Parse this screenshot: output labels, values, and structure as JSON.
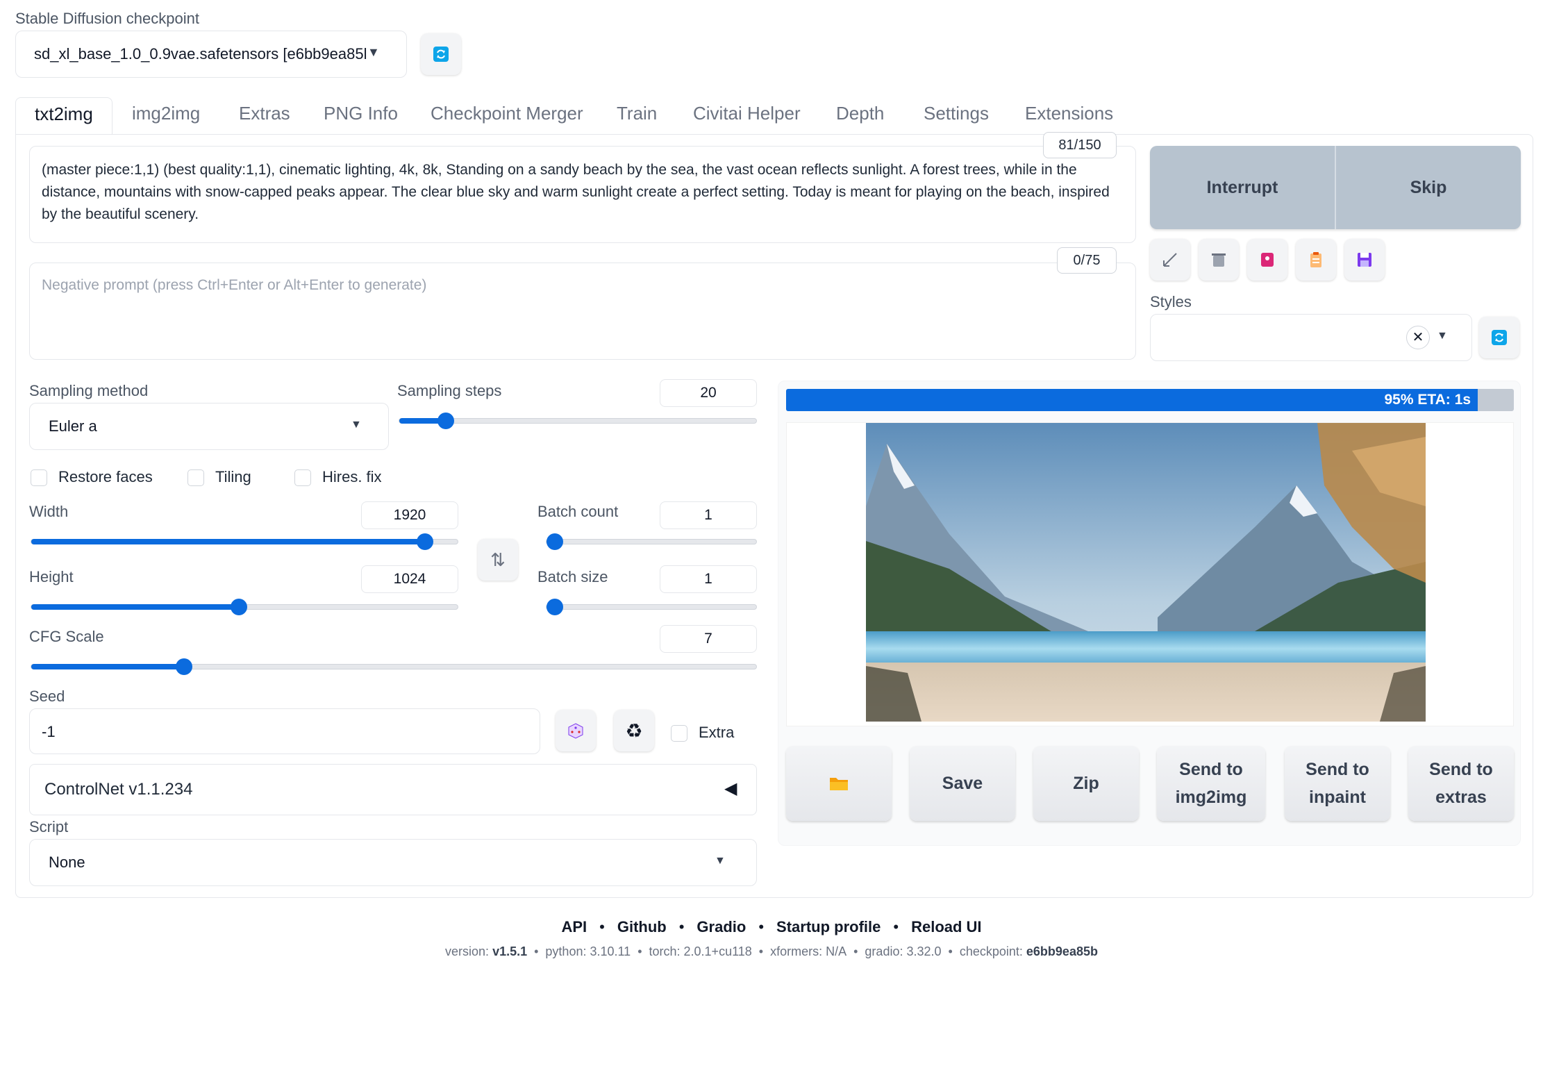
{
  "checkpoint": {
    "label": "Stable Diffusion checkpoint",
    "value": "sd_xl_base_1.0_0.9vae.safetensors [e6bb9ea85l"
  },
  "tabs": [
    "txt2img",
    "img2img",
    "Extras",
    "PNG Info",
    "Checkpoint Merger",
    "Train",
    "Civitai Helper",
    "Depth",
    "Settings",
    "Extensions"
  ],
  "prompt": {
    "counter": "81/150",
    "text": "(master piece:1,1) (best quality:1,1), cinematic lighting, 4k, 8k, Standing on a sandy beach by the sea, the vast ocean reflects sunlight. A forest trees, while in the distance, mountains with snow-capped peaks appear. The clear blue sky and warm sunlight create a perfect setting.  Today is meant for playing on the beach, inspired by the beautiful scenery."
  },
  "negative_prompt": {
    "counter": "0/75",
    "placeholder": "Negative prompt (press Ctrl+Enter or Alt+Enter to generate)"
  },
  "actions": {
    "interrupt": "Interrupt",
    "skip": "Skip"
  },
  "styles": {
    "label": "Styles"
  },
  "sampling": {
    "method_label": "Sampling method",
    "method_value": "Euler a",
    "steps_label": "Sampling steps",
    "steps_value": "20",
    "steps_fraction": 0.13
  },
  "checkboxes": {
    "restore_faces": "Restore faces",
    "tiling": "Tiling",
    "hires_fix": "Hires. fix",
    "extra": "Extra"
  },
  "dimensions": {
    "width_label": "Width",
    "width_value": "1920",
    "width_fraction": 0.92,
    "height_label": "Height",
    "height_value": "1024",
    "height_fraction": 0.485,
    "batch_count_label": "Batch count",
    "batch_count_value": "1",
    "batch_count_fraction": 0.0,
    "batch_size_label": "Batch size",
    "batch_size_value": "1",
    "batch_size_fraction": 0.0
  },
  "cfg": {
    "label": "CFG Scale",
    "value": "7",
    "fraction": 0.21
  },
  "seed": {
    "label": "Seed",
    "value": "-1"
  },
  "controlnet": {
    "label": "ControlNet v1.1.234"
  },
  "script": {
    "label": "Script",
    "value": "None"
  },
  "progress": {
    "fraction": 0.95,
    "text": "95% ETA: 1s"
  },
  "output_buttons": {
    "save": "Save",
    "zip": "Zip",
    "send_img2img_1": "Send to",
    "send_img2img_2": "img2img",
    "send_inpaint_1": "Send to",
    "send_inpaint_2": "inpaint",
    "send_extras_1": "Send to",
    "send_extras_2": "extras"
  },
  "footer": {
    "links": [
      "API",
      "Github",
      "Gradio",
      "Startup profile",
      "Reload UI"
    ],
    "version_label": "version:",
    "version": "v1.5.1",
    "python": "python: 3.10.11",
    "torch": "torch: 2.0.1+cu118",
    "xformers": "xformers: N/A",
    "gradio": "gradio: 3.32.0",
    "checkpoint_label": "checkpoint:",
    "checkpoint": "e6bb9ea85b"
  },
  "colors": {
    "accent": "#0b6bde",
    "action_button": "#b7c3cf",
    "progress_bg": "#c3cad3"
  },
  "icons": {
    "refresh": "refresh-icon",
    "dice": "dice-icon",
    "recycle": "recycle-icon",
    "folder": "folder-icon"
  }
}
